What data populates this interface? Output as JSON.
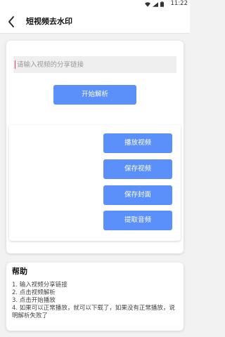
{
  "status_bar": {
    "time": "11:22",
    "icons": [
      "wifi-icon",
      "signal-icon",
      "battery-icon"
    ]
  },
  "app_bar": {
    "title": "短视频去水印",
    "back_icon": "back-arrow-icon"
  },
  "url_input": {
    "placeholder": "请输入视频的分享链接",
    "value": ""
  },
  "parse_button": {
    "label": "开始解析"
  },
  "actions": {
    "play": "播放视频",
    "save_video": "保存视频",
    "save_cover": "保存封面",
    "extract_audio": "提取音频"
  },
  "help": {
    "title": "帮助",
    "steps": [
      "1. 输入视频分享链接",
      "2. 点击视频解析",
      "3. 点击开始播放",
      "4. 如果可以正常播放，就可以下载了，如果没有正常播放，说明解析失败了"
    ]
  },
  "colors": {
    "accent": "#5b8ff9",
    "background": "#f2f2f2",
    "card": "#ffffff",
    "input_bg": "#efefef",
    "caret": "#e0407b"
  }
}
